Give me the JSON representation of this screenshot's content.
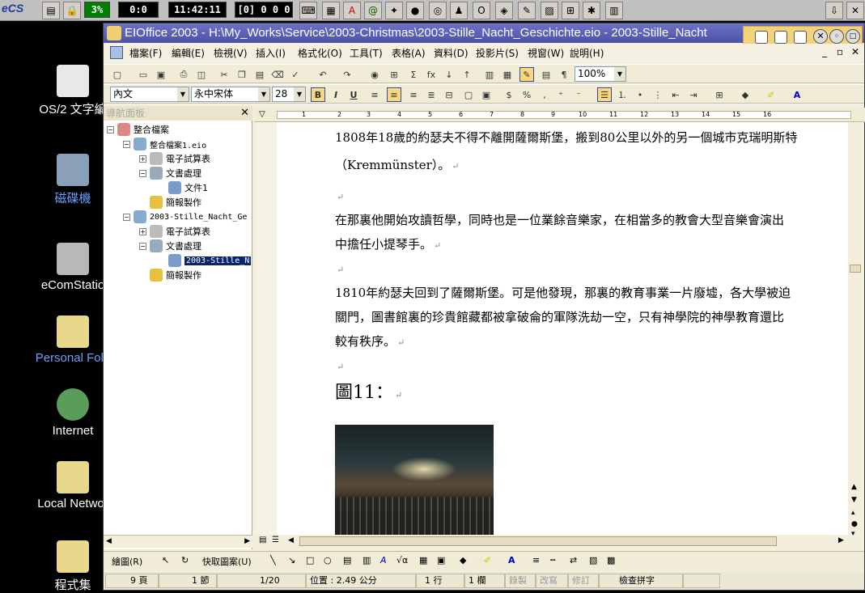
{
  "taskbar": {
    "cpu": "3%",
    "counter": "0:0",
    "clock": "11:42:11",
    "status": "[0] 0 0 0",
    "logo": "eCS"
  },
  "desktop": {
    "icons": [
      {
        "label": "OS/2 文字編",
        "icon": "pen-icon"
      },
      {
        "label": "磁碟機",
        "icon": "drives-icon"
      },
      {
        "label": "eComStatio",
        "icon": "computer-icon"
      },
      {
        "label": "Personal Fold",
        "icon": "folder-icon"
      },
      {
        "label": "Internet",
        "icon": "globe-folder-icon"
      },
      {
        "label": "Local Networ",
        "icon": "network-folder-icon"
      },
      {
        "label": "程式集",
        "icon": "programs-folder-icon"
      }
    ]
  },
  "window": {
    "title": "EIOffice 2003 - H:\\My_Works\\Service\\2003-Christmas\\2003-Stille_Nacht_Geschichte.eio - 2003-Stille_Nacht",
    "menu": [
      "檔案(F)",
      "編輯(E)",
      "檢視(V)",
      "插入(I)",
      "格式化(O)",
      "工具(T)",
      "表格(A)",
      "資料(D)",
      "投影片(S)",
      "視窗(W)",
      "說明(H)"
    ],
    "zoom": "100%",
    "style": "內文",
    "font": "永中宋体",
    "size": "28"
  },
  "nav": {
    "title": "導航面板",
    "items": [
      {
        "label": "整合檔案",
        "level": 0
      },
      {
        "label": "整合檔案1.eio",
        "level": 1
      },
      {
        "label": "電子試算表",
        "level": 2
      },
      {
        "label": "文書處理",
        "level": 2
      },
      {
        "label": "文件1",
        "level": 3
      },
      {
        "label": "簡報製作",
        "level": 2
      },
      {
        "label": "2003-Stille_Nacht_Ge",
        "level": 1
      },
      {
        "label": "電子試算表",
        "level": 2
      },
      {
        "label": "文書處理",
        "level": 2
      },
      {
        "label": "2003-Stille_N",
        "level": 3
      },
      {
        "label": "簡報製作",
        "level": 2
      }
    ]
  },
  "document": {
    "para1": "1808年18歲的約瑟夫不得不離開薩爾斯堡，搬到80公里以外的另一個城市克瑞明斯特",
    "para1b": "（Kremmünster）。",
    "para2": "在那裏他開始攻讀哲學，同時也是一位業餘音樂家，在相當多的教會大型音樂會演出",
    "para2b": "中擔任小提琴手。",
    "para3": "1810年約瑟夫回到了薩爾斯堡。可是他發現，那裏的教育事業一片廢墟，各大學被迫",
    "para3b": "關門，圖書館裏的珍貴館藏都被拿破侖的軍隊洗劫一空，只有神學院的神學教育還比",
    "para3c": "較有秩序。",
    "heading": "圖11：",
    "return_mark": "↵"
  },
  "drawbar": {
    "draw": "繪圖(R)",
    "autoshape": "快取圖案(U)"
  },
  "status": {
    "page": "9 頁",
    "section": "1 節",
    "pages": "1/20",
    "position": "位置 : 2.49 公分",
    "line": "1 行",
    "col": "1 欄",
    "rec": "錄製",
    "ovr": "改寫",
    "rev": "修訂",
    "spell": "檢查拼字"
  },
  "ruler_labels": [
    "1",
    "2",
    "3",
    "4",
    "5",
    "6",
    "7",
    "8",
    "9",
    "10",
    "11",
    "12",
    "13",
    "14",
    "15",
    "16"
  ]
}
